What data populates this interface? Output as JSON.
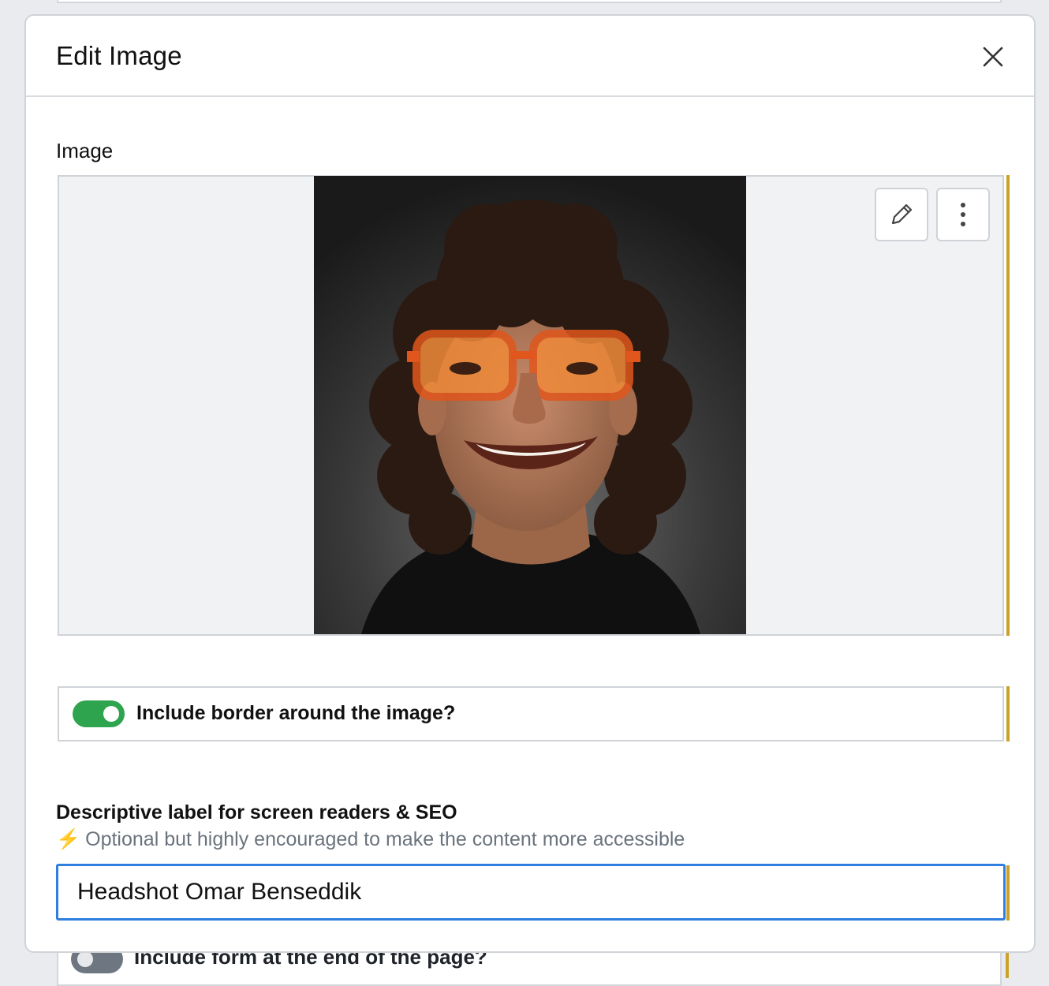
{
  "modal": {
    "title": "Edit Image",
    "close_icon": "close-icon"
  },
  "image_section": {
    "label": "Image",
    "photo_alt": "Headshot Omar Benseddik",
    "edit_icon": "pencil-icon",
    "more_icon": "more-vertical-icon"
  },
  "border_toggle": {
    "label": "Include border around the image?",
    "enabled": true
  },
  "descriptive_label": {
    "label": "Descriptive label for screen readers & SEO",
    "hint_icon": "lightning-icon",
    "hint_icon_glyph": "⚡",
    "hint": "Optional but highly encouraged to make the content more accessible",
    "value": "Headshot Omar Benseddik"
  },
  "background": {
    "form_toggle_label": "Include form at the end of the page?",
    "form_toggle_enabled": false
  },
  "colors": {
    "toggle_on": "#2ea44f",
    "accent_bar": "#c9a227",
    "input_focus": "#2f7ee0"
  }
}
